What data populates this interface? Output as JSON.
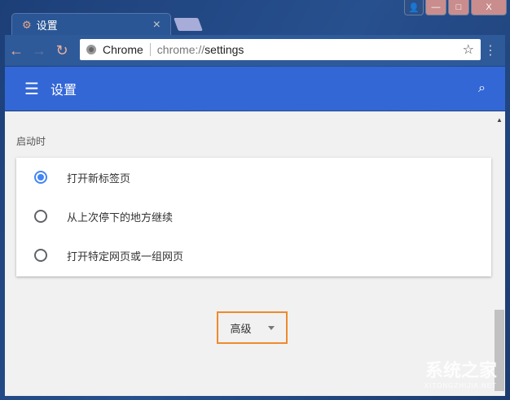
{
  "tab": {
    "title": "设置",
    "close": "×"
  },
  "window": {
    "minimize": "—",
    "maximize": "□",
    "close": "X"
  },
  "omnibox": {
    "site": "Chrome",
    "url_prefix": "chrome://",
    "url_path": "settings"
  },
  "header": {
    "title": "设置"
  },
  "startup": {
    "label": "启动时",
    "options": [
      {
        "label": "打开新标签页",
        "selected": true
      },
      {
        "label": "从上次停下的地方继续",
        "selected": false
      },
      {
        "label": "打开特定网页或一组网页",
        "selected": false
      }
    ]
  },
  "advanced": {
    "label": "高级"
  },
  "watermark": {
    "title": "系统之家",
    "sub": "XITONGZHIJIA.NET"
  },
  "colors": {
    "accent": "#3367d6",
    "highlight": "#f08a2c"
  }
}
